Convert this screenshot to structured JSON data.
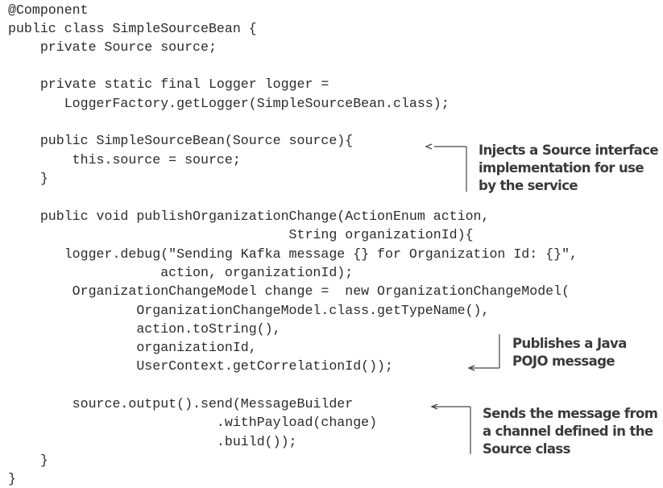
{
  "code": {
    "lines": [
      "@Component",
      "public class SimpleSourceBean {",
      "    private Source source;",
      "",
      "    private static final Logger logger =",
      "       LoggerFactory.getLogger(SimpleSourceBean.class);",
      "",
      "    public SimpleSourceBean(Source source){",
      "        this.source = source;",
      "    }",
      "",
      "    public void publishOrganizationChange(ActionEnum action,",
      "                                   String organizationId){",
      "       logger.debug(\"Sending Kafka message {} for Organization Id: {}\",",
      "                   action, organizationId);",
      "        OrganizationChangeModel change =  new OrganizationChangeModel(",
      "                OrganizationChangeModel.class.getTypeName(),",
      "                action.toString(),",
      "                organizationId,",
      "                UserContext.getCorrelationId());",
      "",
      "        source.output().send(MessageBuilder",
      "                          .withPayload(change)",
      "                          .build());",
      "    }",
      "}"
    ]
  },
  "annotations": [
    {
      "id": "inject-source",
      "lines": [
        "Injects a Source interface",
        "implementation for use",
        "by the service"
      ]
    },
    {
      "id": "publish-pojo",
      "lines": [
        "Publishes a Java",
        "POJO message"
      ]
    },
    {
      "id": "send-message",
      "lines": [
        "Sends the message from",
        "a channel defined in the",
        "Source class"
      ]
    }
  ],
  "colors": {
    "text": "#2b2b2b",
    "annotation": "#3a3a3a",
    "connector": "#444444"
  }
}
